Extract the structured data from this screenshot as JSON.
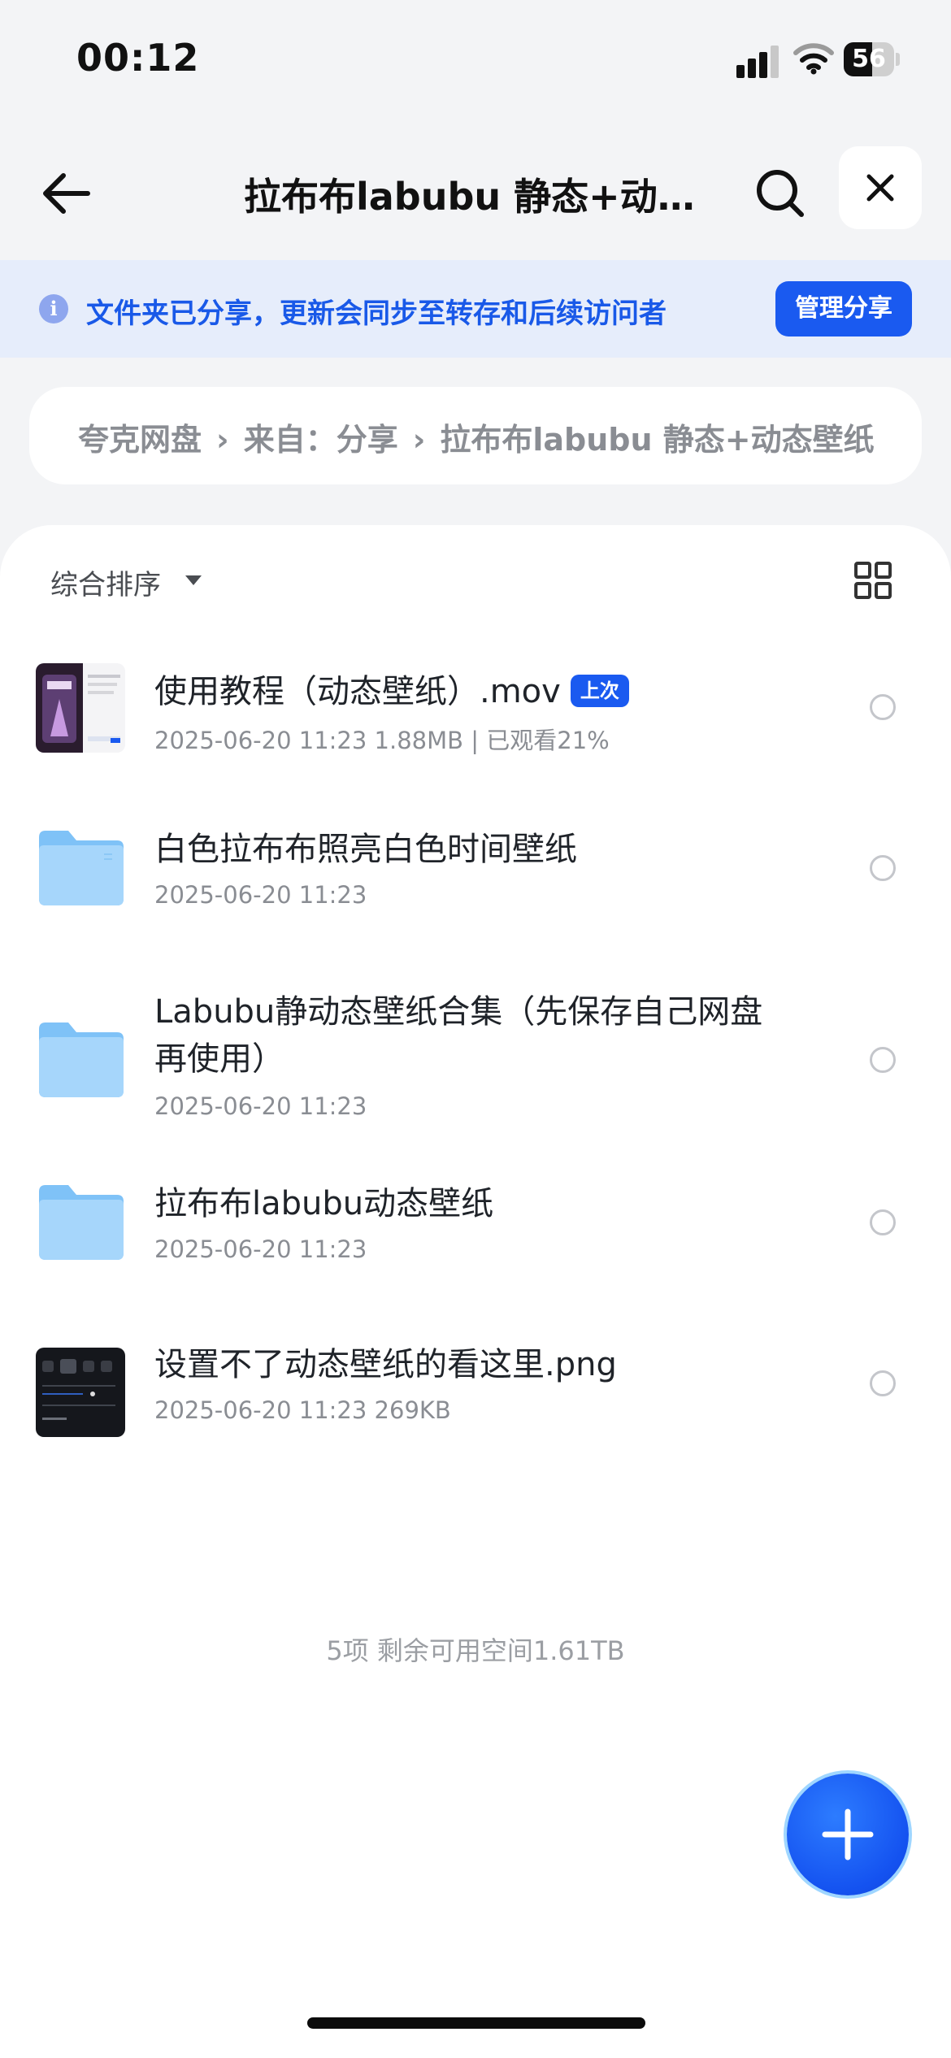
{
  "status": {
    "time": "00:12",
    "battery": "56",
    "battery_level_fraction": 0.56
  },
  "nav": {
    "title": "拉布布labubu 静态+动态壁纸",
    "back_icon": "arrow-left-icon",
    "search_icon": "search-icon",
    "close_icon": "close-icon"
  },
  "banner": {
    "icon": "info-icon",
    "text": "文件夹已分享，更新会同步至转存和后续访问者",
    "button": "管理分享"
  },
  "breadcrumb": {
    "items": [
      "夸克网盘",
      "来自：分享",
      "拉布布labubu 静态+动态壁纸"
    ]
  },
  "toolbar": {
    "sort_label": "综合排序",
    "view_icon": "grid-view-icon"
  },
  "files": [
    {
      "name": "使用教程（动态壁纸）.mov",
      "badge": "上次",
      "meta": "2025-06-20 11:23  1.88MB | 已观看21%",
      "kind": "video"
    },
    {
      "name": "白色拉布布照亮白色时间壁纸",
      "meta": "2025-06-20 11:23",
      "kind": "folder"
    },
    {
      "name": "Labubu静动态壁纸合集（先保存自己网盘再使用）",
      "meta": "2025-06-20 11:23",
      "kind": "folder"
    },
    {
      "name": "拉布布labubu动态壁纸",
      "meta": "2025-06-20 11:23",
      "kind": "folder"
    },
    {
      "name": "设置不了动态壁纸的看这里.png",
      "meta": "2025-06-20 11:23  269KB",
      "kind": "image"
    }
  ],
  "summary": "5项 剩余可用空间1.61TB",
  "fab_icon": "plus-icon",
  "colors": {
    "accent": "#1a5af0",
    "banner_bg": "#e6edfb",
    "folder": "#7fc2f7"
  }
}
